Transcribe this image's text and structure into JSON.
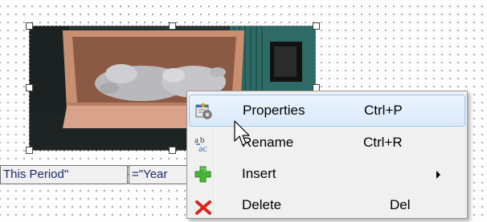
{
  "report_fields": {
    "field_left": "This Period\"",
    "field_right": "=\"Year"
  },
  "context_menu": {
    "items": [
      {
        "label": "Properties",
        "shortcut": "Ctrl+P",
        "icon": "properties-icon",
        "highlighted": true
      },
      {
        "label": "Rename",
        "shortcut": "Ctrl+R",
        "icon": "rename-icon",
        "highlighted": false
      },
      {
        "label": "Insert",
        "shortcut": "",
        "icon": "insert-plus-icon",
        "has_submenu": true
      },
      {
        "label": "Delete",
        "shortcut": "Del",
        "icon": "delete-x-icon",
        "highlighted": false
      }
    ]
  },
  "colors": {
    "menu_bg": "#f0f0f0",
    "hover_border": "#9ac2ea",
    "field_text": "#1a2a6a",
    "plus_green": "#46b535",
    "delete_red": "#d9261c"
  }
}
